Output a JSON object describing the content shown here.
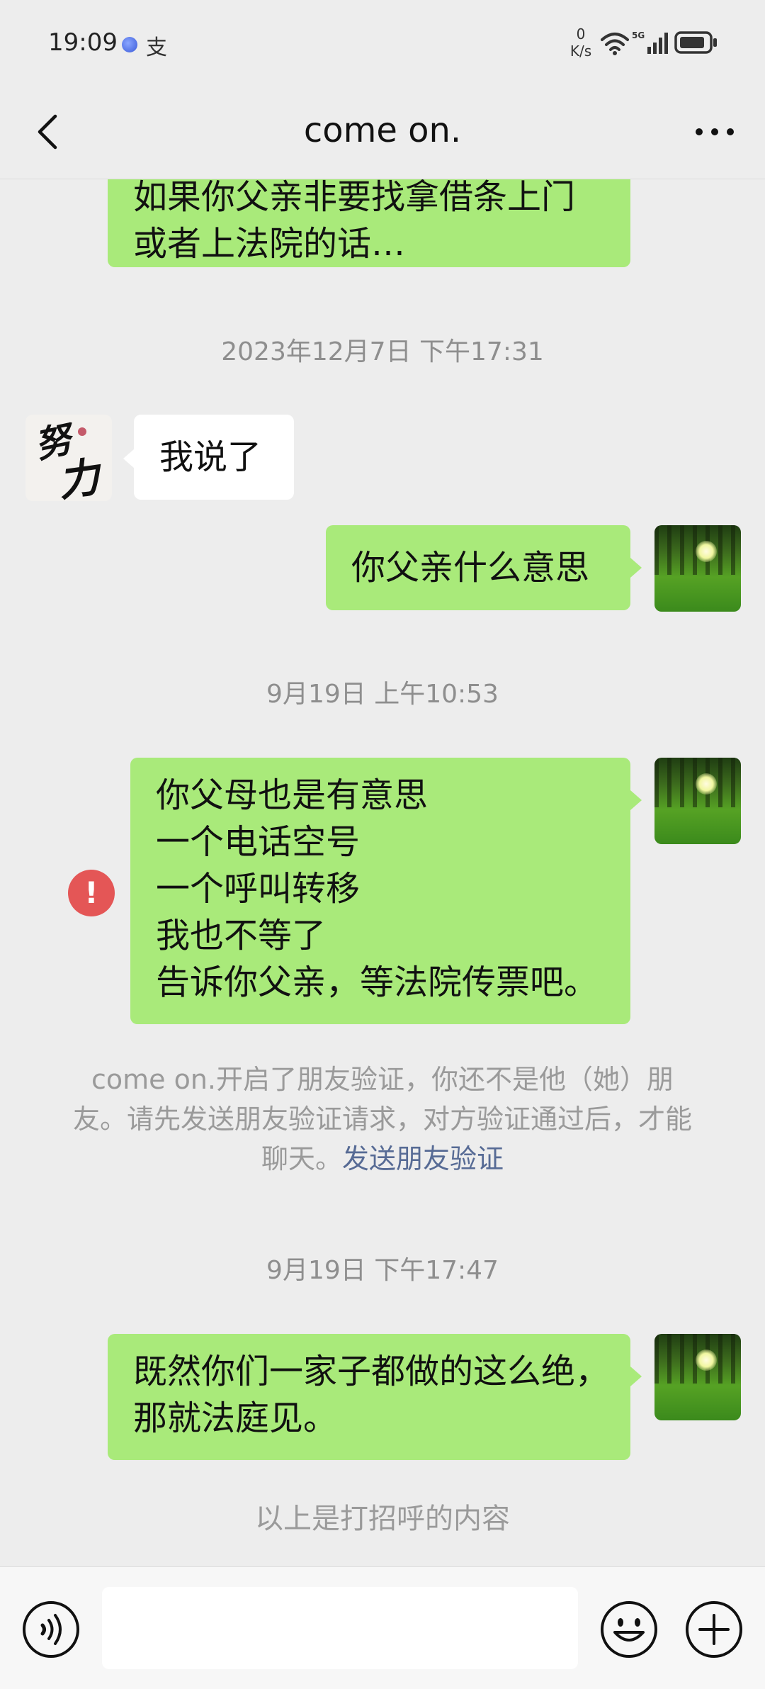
{
  "status_bar": {
    "time": "19:09",
    "app_char": "支",
    "net_speed_value": "0",
    "net_speed_unit": "K/s",
    "network_label": "5G"
  },
  "nav": {
    "title": "come on."
  },
  "messages": {
    "m1": {
      "lines": [
        "如果你父亲非要找拿借条上门",
        "或者上法院的话…"
      ]
    },
    "ts1": "2023年12月7日 下午17:31",
    "m2": {
      "text": "我说了"
    },
    "m3": {
      "text": "你父亲什么意思"
    },
    "ts2": "9月19日 上午10:53",
    "m4": {
      "lines": [
        "你父母也是有意思",
        "一个电话空号",
        "一个呼叫转移",
        "我也不等了",
        "告诉你父亲，等法院传票吧。"
      ]
    },
    "error_mark": "!",
    "notice": {
      "text": "come on.开启了朋友验证，你还不是他（她）朋友。请先发送朋友验证请求，对方验证通过后，才能聊天。",
      "link": "发送朋友验证"
    },
    "ts3": "9月19日 下午17:47",
    "m5": {
      "lines": [
        "既然你们一家子都做的这么绝，",
        "那就法庭见。"
      ]
    },
    "greet_notice": "以上是打招呼的内容"
  },
  "friend_avatar": {
    "calligraphy_chars": [
      "努",
      "力"
    ]
  },
  "input_bar": {
    "value": "",
    "placeholder": ""
  },
  "colors": {
    "background": "#ededed",
    "sent_bubble": "#a9ea7a",
    "received_bubble": "#ffffff",
    "error": "#e45656",
    "link": "#576b95"
  }
}
